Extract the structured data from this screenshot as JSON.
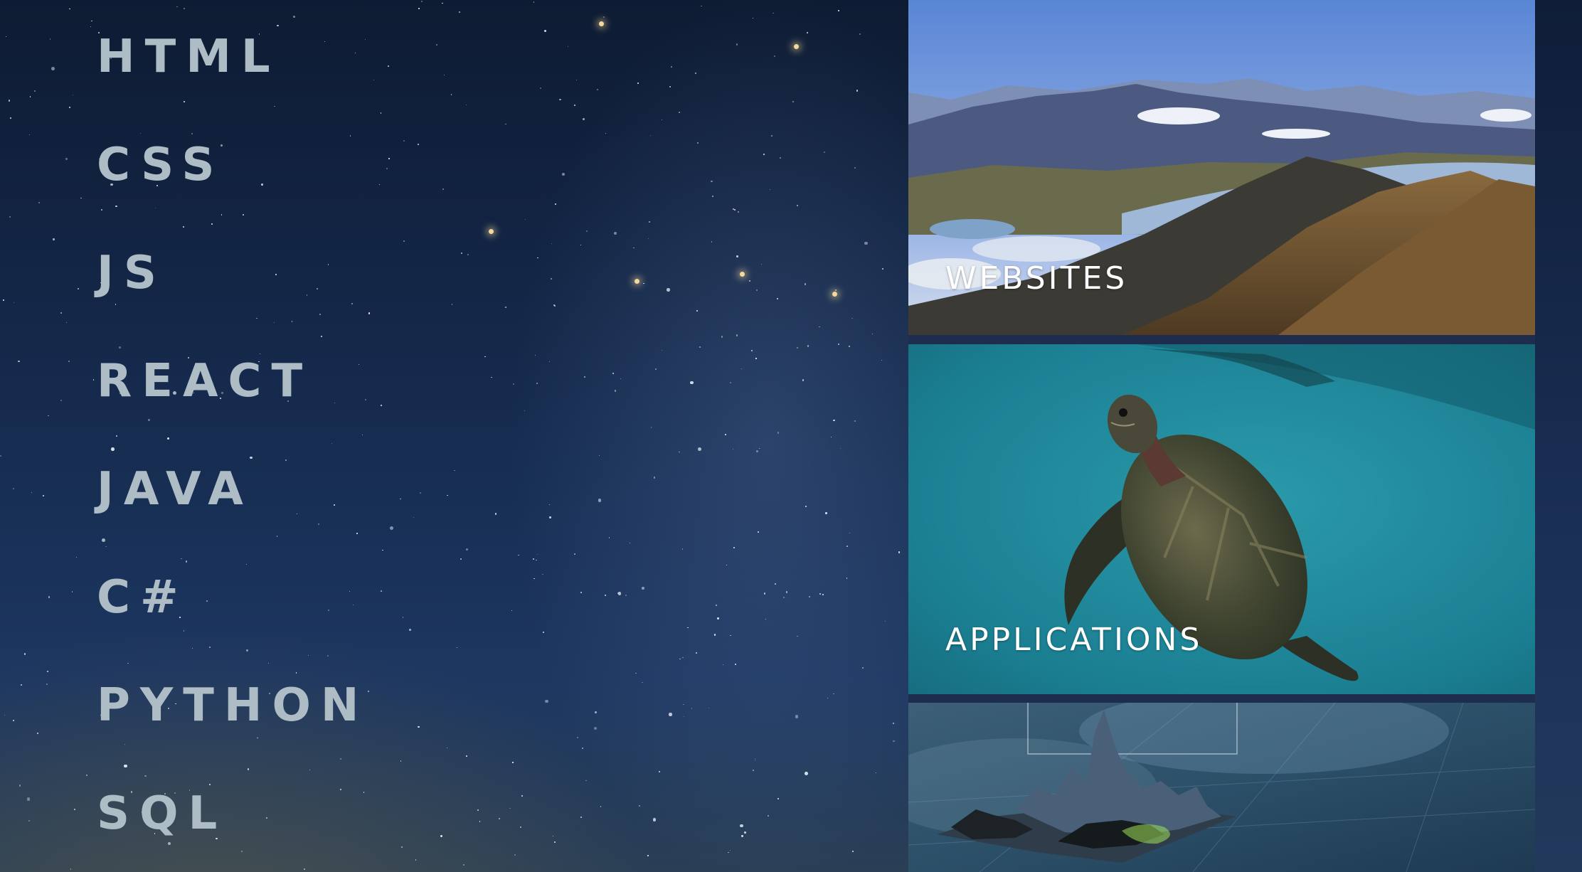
{
  "skills": [
    "HTML",
    "CSS",
    "JS",
    "REACT",
    "JAVA",
    "C#",
    "PYTHON",
    "SQL"
  ],
  "tiles": [
    {
      "label": "WEBSITES",
      "image": "mountain-lake-landscape"
    },
    {
      "label": "APPLICATIONS",
      "image": "sea-turtle-underwater"
    },
    {
      "label": "",
      "image": "3d-terrain-visualization"
    }
  ],
  "colors": {
    "skill_text": "#aebdc5",
    "tile_label": "#ffffff",
    "sky_dark": "#0e1b33",
    "sky_mid": "#1d3761"
  }
}
